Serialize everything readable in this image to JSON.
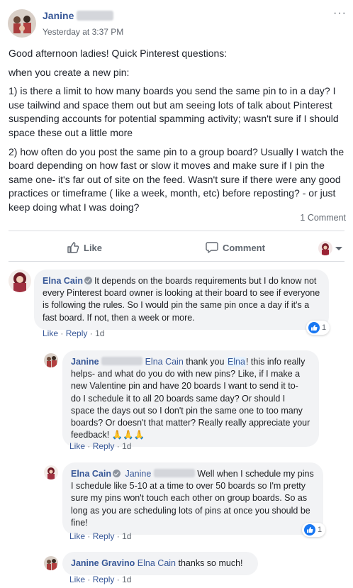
{
  "post": {
    "author_first": "Janine",
    "timestamp": "Yesterday at 3:37 PM",
    "more": "···",
    "paragraphs": [
      "Good afternoon ladies! Quick Pinterest questions:",
      "when you create a new pin:",
      "1) is there a limit to how many boards you send the same pin to in a day? I use tailwind and space them out but am seeing lots of talk about Pinterest suspending accounts for potential spamming activity; wasn't sure if I should space these out a little more",
      "2) how often do you post the same pin to a group board? Usually I watch the board depending on how fast or slow it moves and make sure if I pin the same one- it's far out of site on the feed. Wasn't sure if there were any good practices or timeframe ( like a week, month, etc) before reposting? - or just keep doing what I was doing?"
    ],
    "comment_count": "1 Comment"
  },
  "actions": {
    "like": "Like",
    "comment": "Comment"
  },
  "comments": [
    {
      "author": "Elna Cain",
      "text": "It depends on the boards requirements but I do know not every Pinterest board owner is looking at their board to see if everyone is following the rules. So I would pin the same pin once a day if it's a fast board. If not, then a week or more.",
      "like": "Like",
      "reply": "Reply",
      "age": "1d",
      "reactions": "1"
    },
    {
      "author": "Janine",
      "mention": "Elna Cain",
      "text_a": " thank you ",
      "mention2": "Elna",
      "text_b": "! this info really helps- and what do you do with new pins? Like, if I make a new Valentine pin and have 20 boards I want to send it to- do I schedule it to all 20 boards same day? Or should I space the days out so I don't pin the same one to too many boards? Or doesn't that matter? Really really appreciate your feedback! 🙏🙏🙏",
      "like": "Like",
      "reply": "Reply",
      "age": "1d"
    },
    {
      "author": "Elna Cain",
      "mention": "Janine",
      "text": "Well when I schedule my pins I schedule like 5-10 at a time to over 50 boards so I'm pretty sure my pins won't touch each other on group boards. So as long as you are scheduling lots of pins at once you should be fine!",
      "like": "Like",
      "reply": "Reply",
      "age": "1d",
      "reactions": "1"
    },
    {
      "author": "Janine Gravino",
      "mention": "Elna Cain",
      "text": "thanks so much!",
      "like": "Like",
      "reply": "Reply",
      "age": "1d"
    }
  ],
  "meta_sep": "·",
  "colors": {
    "link": "#385898",
    "bubble": "#f2f3f5",
    "like_blue": "#1877f2",
    "muted": "#606770"
  }
}
